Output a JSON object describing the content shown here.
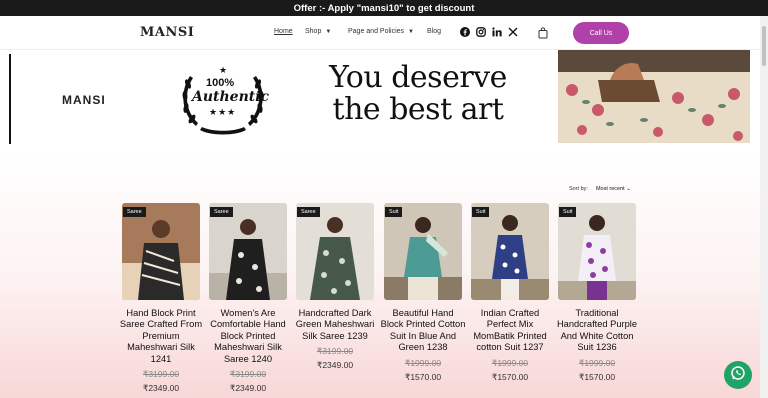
{
  "topbar": {
    "offer": "Offer :- Apply \"mansi10\" to get discount"
  },
  "header": {
    "logo": "MANSI",
    "nav": [
      {
        "label": "Home"
      },
      {
        "label": "Shop"
      },
      {
        "label": "Page and Policies"
      },
      {
        "label": "Blog"
      }
    ],
    "social_icons": [
      "facebook-icon",
      "instagram-icon",
      "linkedin-icon",
      "x-icon"
    ],
    "cart_icon": "shopping-bag-icon",
    "call_button": "Call Us"
  },
  "banner": {
    "brand": "MANSI",
    "badge_top": "100%",
    "badge_main": "Authentic",
    "badge_stars": "★",
    "tagline_line1": "You deserve",
    "tagline_line2": "the best art"
  },
  "sort": {
    "label": "Sort by:",
    "value": "Most recent"
  },
  "products": [
    {
      "tag": "Saree",
      "title": "Hand Block Print Saree Crafted From Premium Maheshwari Silk 1241",
      "price_old": "₹3199.00",
      "price_new": "₹2349.00"
    },
    {
      "tag": "Saree",
      "title": "Women's Are Comfortable Hand Block Printed Maheshwari Silk Saree 1240",
      "price_old": "₹3199.00",
      "price_new": "₹2349.00"
    },
    {
      "tag": "Saree",
      "title": "Handcrafted Dark Green Maheshwari Silk Saree 1239",
      "price_old": "₹3199.00",
      "price_new": "₹2349.00"
    },
    {
      "tag": "Suit",
      "title": "Beautiful Hand Block Printed Cotton Suit In Blue And Green 1238",
      "price_old": "₹1999.00",
      "price_new": "₹1570.00"
    },
    {
      "tag": "Suit",
      "title": "Indian Crafted Perfect Mix MomBatik Printed cotton Suit 1237",
      "price_old": "₹1999.00",
      "price_new": "₹1570.00"
    },
    {
      "tag": "Suit",
      "title": "Traditional Handcrafted Purple And White Cotton Suit 1236",
      "price_old": "₹1999.00",
      "price_new": "₹1570.00"
    }
  ],
  "colors": {
    "accent": "#b041a8",
    "topbar": "#1a1a1a",
    "whatsapp": "#21a366"
  },
  "floating": {
    "whatsapp_icon": "whatsapp-icon"
  }
}
